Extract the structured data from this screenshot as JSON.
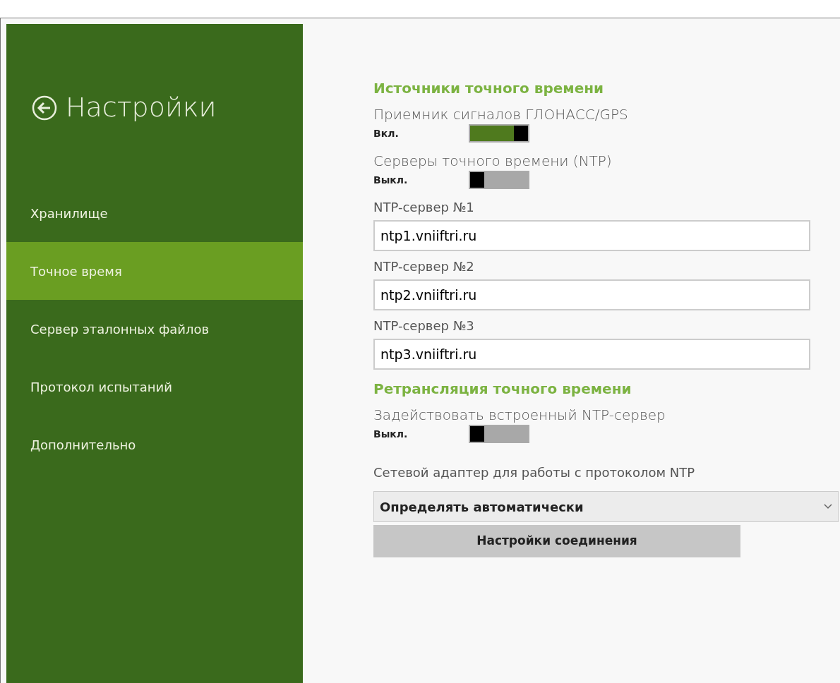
{
  "sidebar": {
    "title": "Настройки",
    "items": [
      {
        "label": "Хранилище",
        "selected": false
      },
      {
        "label": "Точное время",
        "selected": true
      },
      {
        "label": "Сервер эталонных файлов",
        "selected": false
      },
      {
        "label": "Протокол испытаний",
        "selected": false
      },
      {
        "label": "Дополнительно",
        "selected": false
      }
    ]
  },
  "content": [
    {
      "kind": "heading",
      "text": "Источники точного времени"
    },
    {
      "kind": "toggle",
      "label": "Приемник сигналов ГЛОНАСС/GPS",
      "state_text": "Вкл.",
      "on": true
    },
    {
      "kind": "toggle",
      "label": "Серверы точного времени (NTP)",
      "state_text": "Выкл.",
      "on": false
    },
    {
      "kind": "field",
      "label": "NTP-сервер №1",
      "value": "ntp1.vniiftri.ru"
    },
    {
      "kind": "field",
      "label": "NTP-сервер №2",
      "value": "ntp2.vniiftri.ru"
    },
    {
      "kind": "field",
      "label": "NTP-сервер №3",
      "value": "ntp3.vniiftri.ru"
    },
    {
      "kind": "heading",
      "text": "Ретрансляция точного времени"
    },
    {
      "kind": "toggle",
      "label": "Задействовать встроенный NTP-сервер",
      "state_text": "Выкл.",
      "on": false
    },
    {
      "kind": "select",
      "label": "Сетевой адаптер для работы с протоколом NTP",
      "value": "Определять автоматически"
    },
    {
      "kind": "button",
      "text": "Настройки соединения"
    }
  ]
}
